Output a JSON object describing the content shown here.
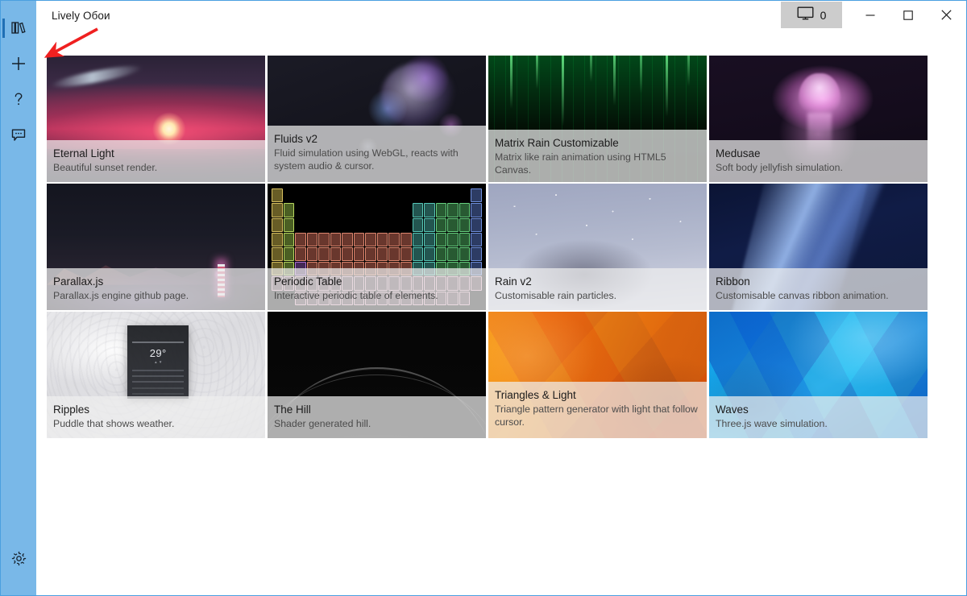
{
  "window": {
    "title": "Lively Обои",
    "screen_count": "0",
    "screen_icon": "monitor-icon",
    "minimize_label": "─",
    "maximize_label": "□",
    "close_label": "✕"
  },
  "sidebar": {
    "items": [
      {
        "id": "library",
        "icon": "library-books-icon",
        "selected": true
      },
      {
        "id": "add",
        "icon": "plus-icon",
        "selected": false
      },
      {
        "id": "help",
        "icon": "question-mark-icon",
        "selected": false
      },
      {
        "id": "feedback",
        "icon": "chat-bubble-icon",
        "selected": false
      }
    ],
    "bottom": {
      "id": "settings",
      "icon": "gear-icon"
    }
  },
  "annotation": {
    "type": "arrow",
    "color": "#ef2020"
  },
  "library": {
    "wallpapers": [
      {
        "title": "Eternal Light",
        "description": "Beautiful sunset render.",
        "thumb": "t-eternal"
      },
      {
        "title": "Fluids v2",
        "description": "Fluid simulation using WebGL, reacts with system audio & cursor.",
        "thumb": "t-fluids"
      },
      {
        "title": "Matrix Rain Customizable",
        "description": "Matrix like rain animation using HTML5 Canvas.",
        "thumb": "t-matrix"
      },
      {
        "title": "Medusae",
        "description": "Soft body jellyfish simulation.",
        "thumb": "t-medusae"
      },
      {
        "title": "Parallax.js",
        "description": "Parallax.js engine github page.",
        "thumb": "t-parallax"
      },
      {
        "title": "Periodic Table",
        "description": "Interactive periodic table of elements.",
        "thumb": "t-periodic"
      },
      {
        "title": "Rain v2",
        "description": "Customisable rain particles.",
        "thumb": "t-rain"
      },
      {
        "title": "Ribbon",
        "description": "Customisable canvas ribbon animation.",
        "thumb": "t-ribbon"
      },
      {
        "title": "Ripples",
        "description": "Puddle that shows weather.",
        "thumb": "t-ripples",
        "widget_temp": "29°"
      },
      {
        "title": "The Hill",
        "description": "Shader generated hill.",
        "thumb": "t-hill"
      },
      {
        "title": "Triangles & Light",
        "description": "Triangle pattern generator with light that follow cursor.",
        "thumb": "t-triangles"
      },
      {
        "title": "Waves",
        "description": "Three.js wave simulation.",
        "thumb": "t-waves"
      }
    ]
  },
  "colors": {
    "sidebar": "#79b8e8",
    "sidebar_selected_bar": "#1f6fb5",
    "window_border": "#4a9fe0",
    "caption_overlay": "rgba(238,238,238,.72)",
    "arrow": "#ef2020"
  }
}
